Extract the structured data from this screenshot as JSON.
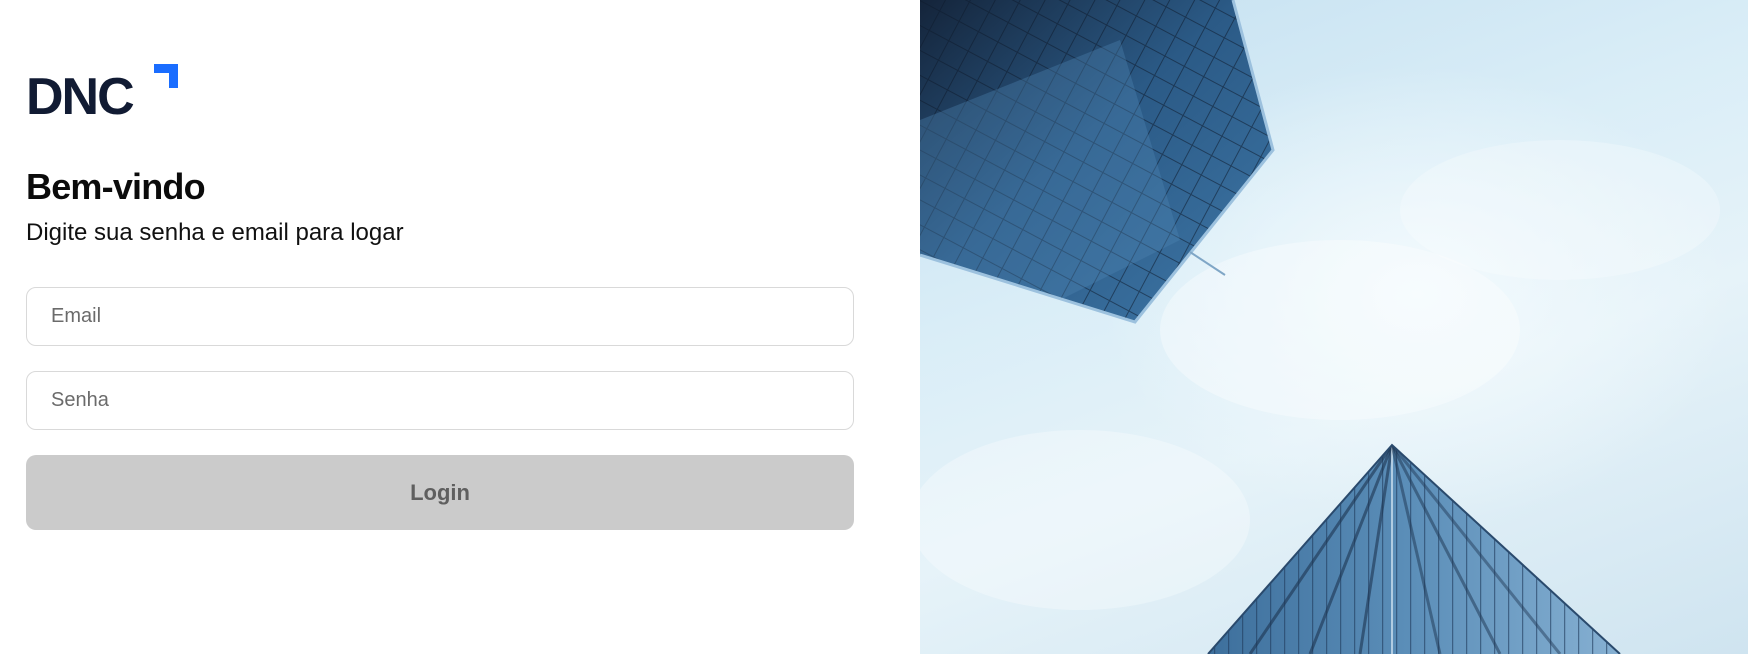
{
  "brand": {
    "logo_text": "DNC",
    "accent_color": "#1a6dff",
    "logo_color": "#111b33"
  },
  "login": {
    "title": "Bem-vindo",
    "subtitle": "Digite sua senha e email para logar",
    "email_placeholder": "Email",
    "password_placeholder": "Senha",
    "login_label": "Login",
    "button_color": "#cbcbcb"
  },
  "hero": {
    "icon": "skyscrapers-image"
  }
}
